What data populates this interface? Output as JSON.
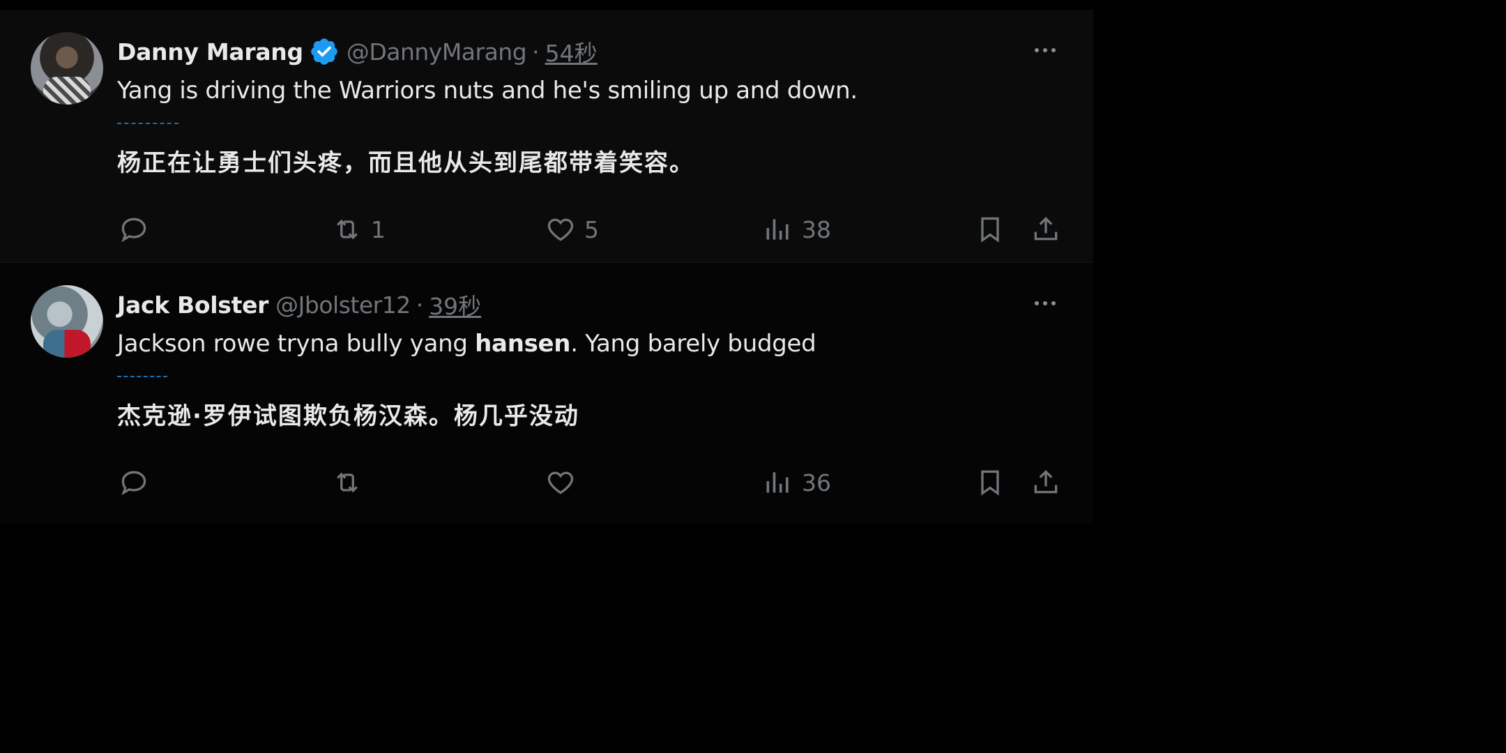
{
  "tweets": [
    {
      "name": "Danny Marang",
      "verified": true,
      "handle": "@DannyMarang",
      "separator": "·",
      "time": "54秒",
      "text_en": "Yang is driving the Warriors nuts and he's smiling up and down.",
      "text_zh": "杨正在让勇士们头疼，而且他从头到尾都带着笑容。",
      "replies": "",
      "retweets": "1",
      "likes": "5",
      "views": "38"
    },
    {
      "name": "Jack Bolster",
      "verified": false,
      "handle": "@Jbolster12",
      "separator": "·",
      "time": "39秒",
      "text_en_before": "Jackson rowe tryna bully yang ",
      "text_en_bold": "hansen",
      "text_en_after": ". Yang barely budged",
      "text_zh": "杰克逊·罗伊试图欺负杨汉森。杨几乎没动",
      "replies": "",
      "retweets": "",
      "likes": "",
      "views": "36"
    }
  ],
  "colors": {
    "background": "#000000",
    "text": "#e7e9ea",
    "muted": "#71767b",
    "verified_blue": "#1d9bf0",
    "divider": "#1d6fb0"
  },
  "icons": [
    "reply-icon",
    "retweet-icon",
    "like-icon",
    "views-icon",
    "bookmark-icon",
    "share-icon",
    "more-icon",
    "verified-badge-icon"
  ]
}
